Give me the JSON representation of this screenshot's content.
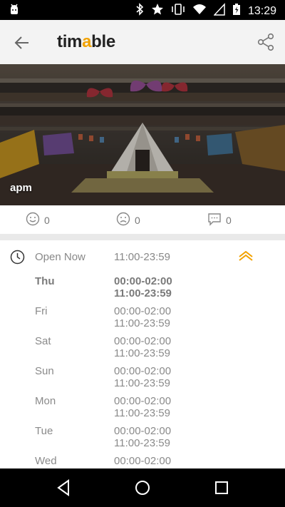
{
  "status_bar": {
    "time": "13:29"
  },
  "app_bar": {
    "logo_prefix": "tim",
    "logo_accent": "a",
    "logo_suffix": "ble"
  },
  "hero": {
    "label": "apm"
  },
  "reactions": {
    "happy_count": "0",
    "sad_count": "0",
    "comment_count": "0"
  },
  "hours": {
    "open_label": "Open Now",
    "open_time": "11:00-23:59",
    "accent_color": "#f2a200",
    "days": [
      {
        "day": "Thu",
        "line1": "00:00-02:00",
        "line2": "11:00-23:59"
      },
      {
        "day": "Fri",
        "line1": "00:00-02:00",
        "line2": "11:00-23:59"
      },
      {
        "day": "Sat",
        "line1": "00:00-02:00",
        "line2": "11:00-23:59"
      },
      {
        "day": "Sun",
        "line1": "00:00-02:00",
        "line2": "11:00-23:59"
      },
      {
        "day": "Mon",
        "line1": "00:00-02:00",
        "line2": "11:00-23:59"
      },
      {
        "day": "Tue",
        "line1": "00:00-02:00",
        "line2": "11:00-23:59"
      },
      {
        "day": "Wed",
        "line1": "00:00-02:00",
        "line2": ""
      }
    ]
  }
}
